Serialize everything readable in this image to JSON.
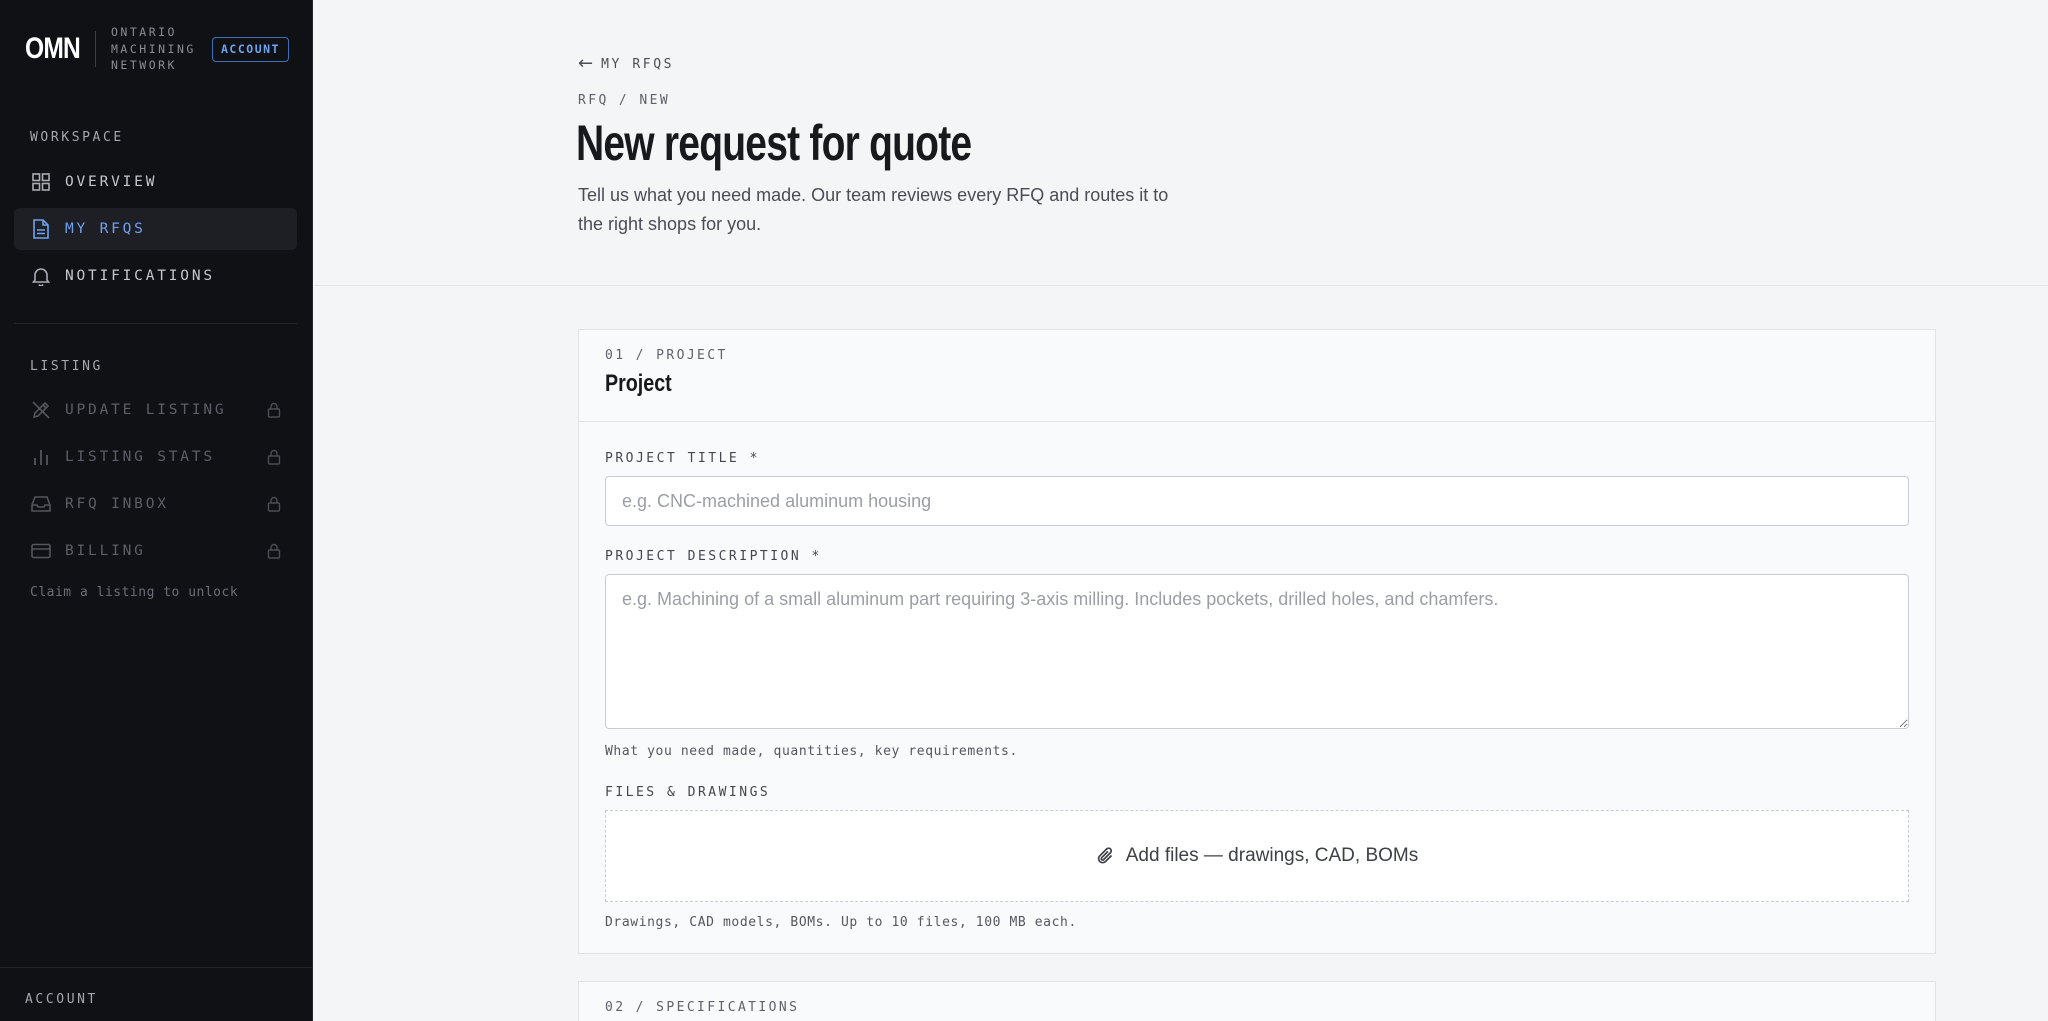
{
  "sidebar": {
    "brand_logo": "OMN",
    "brand_name_lines": [
      "ONTARIO",
      "MACHINING",
      "NETWORK"
    ],
    "badge": "ACCOUNT",
    "workspace_title": "WORKSPACE",
    "workspace_items": [
      {
        "label": "OVERVIEW",
        "icon": "grid-icon",
        "active": false
      },
      {
        "label": "MY RFQS",
        "icon": "document-icon",
        "active": true
      },
      {
        "label": "NOTIFICATIONS",
        "icon": "bell-icon",
        "active": false
      }
    ],
    "listing_title": "LISTING",
    "listing_items": [
      {
        "label": "UPDATE LISTING",
        "icon": "edit-icon",
        "locked": true
      },
      {
        "label": "LISTING STATS",
        "icon": "bar-chart-icon",
        "locked": true
      },
      {
        "label": "RFQ INBOX",
        "icon": "inbox-icon",
        "locked": true
      },
      {
        "label": "BILLING",
        "icon": "credit-card-icon",
        "locked": true
      }
    ],
    "unlock_hint": "Claim a listing to unlock",
    "account_label": "ACCOUNT"
  },
  "header": {
    "back_label": "MY RFQS",
    "breadcrumb": "RFQ / NEW",
    "title": "New request for quote",
    "description": "Tell us what you need made. Our team reviews every RFQ and routes it to the right shops for you."
  },
  "project_card": {
    "step": "01 / PROJECT",
    "title": "Project",
    "title_label": "PROJECT TITLE *",
    "title_placeholder": "e.g. CNC-machined aluminum housing",
    "title_value": "",
    "description_label": "PROJECT DESCRIPTION *",
    "description_placeholder": "e.g. Machining of a small aluminum part requiring 3-axis milling. Includes pockets, drilled holes, and chamfers.",
    "description_value": "",
    "description_hint": "What you need made, quantities, key requirements.",
    "files_label": "FILES & DRAWINGS",
    "files_button": "Add files — drawings, CAD, BOMs",
    "files_hint": "Drawings, CAD models, BOMs. Up to 10 files, 100 MB each."
  },
  "specs_card": {
    "step": "02 / SPECIFICATIONS"
  },
  "colors": {
    "sidebar_bg": "#101115",
    "accent": "#6ea2ef",
    "page_bg": "#f4f5f7"
  }
}
